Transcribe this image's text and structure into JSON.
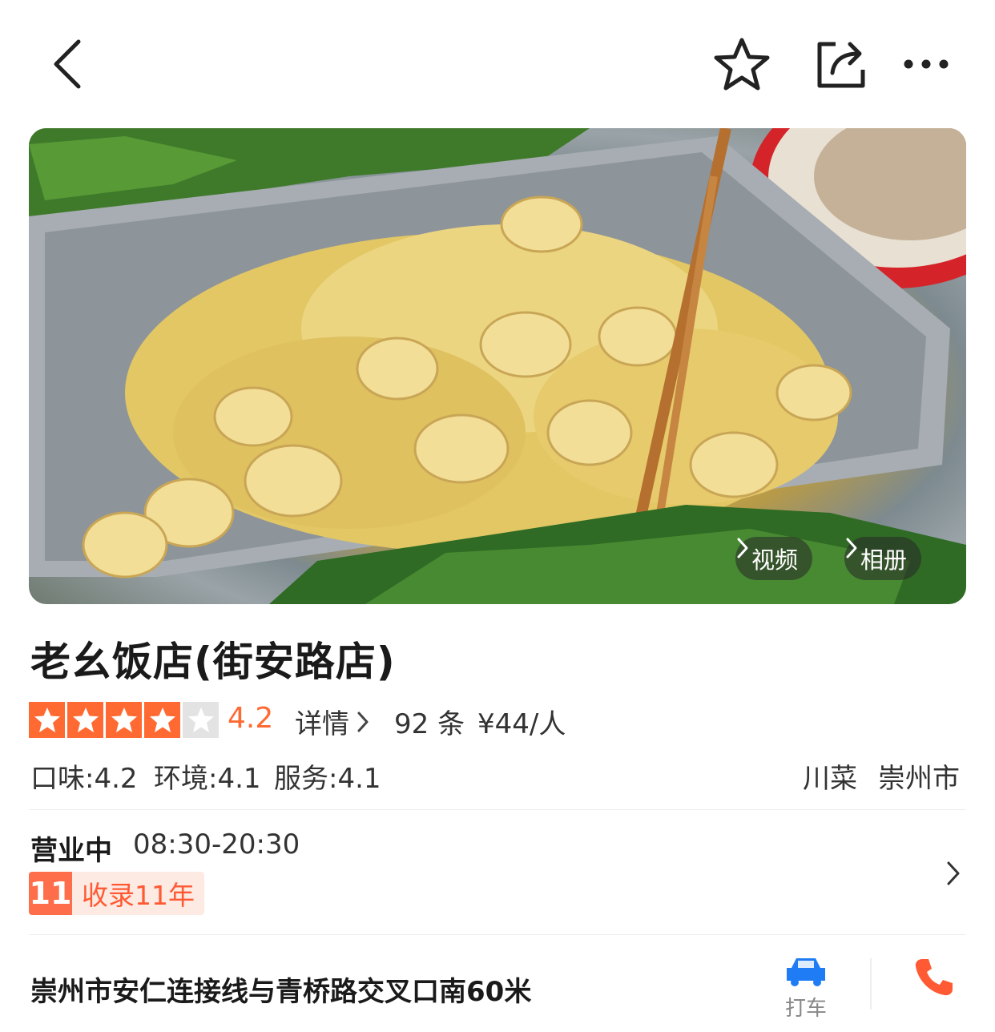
{
  "topbar": {
    "back_icon": "chevron-left-icon",
    "favorite_icon": "star-outline-icon",
    "share_icon": "share-icon",
    "more_icon": "more-dots-icon"
  },
  "hero": {
    "video_label": "视频",
    "album_label": "相册"
  },
  "restaurant": {
    "name": "老幺饭店(街安路店)",
    "rating": "4.2",
    "rating_stars": 4,
    "details_label": "详情",
    "review_count": "92 条",
    "price": "¥44/人",
    "taste": "口味:4.2",
    "environment": "环境:4.1",
    "service": "服务:4.1",
    "cuisine": "川菜",
    "city": "崇州市"
  },
  "hours": {
    "status": "营业中",
    "time": "08:30-20:30",
    "badge_num": "11",
    "badge_text": "收录11年"
  },
  "address": {
    "text": "崇州市安仁连接线与青桥路交叉口南60米",
    "taxi_label": "打车",
    "accent_color": "#ff5a33",
    "taxi_color": "#1f7cf5"
  }
}
